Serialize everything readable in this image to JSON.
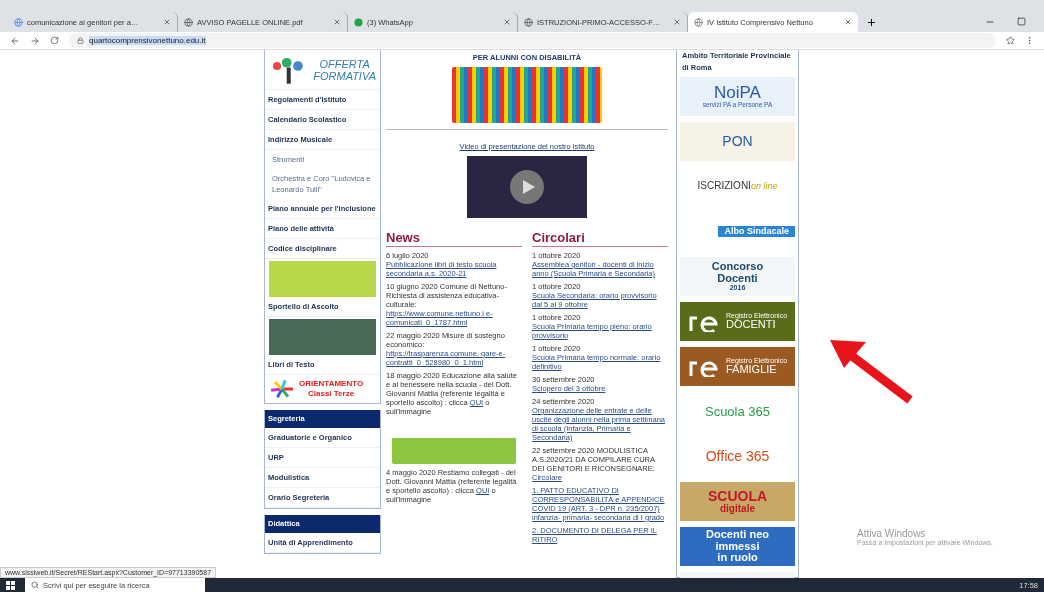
{
  "browser": {
    "tabs": [
      {
        "title": "comunicazione ai genitori per a…",
        "selected": false
      },
      {
        "title": "AVVISO PAGELLE ONLINE.pdf",
        "selected": false
      },
      {
        "title": "(3) WhatsApp",
        "selected": false
      },
      {
        "title": "ISTRUZIONI-PRIMO-ACCESSO-F…",
        "selected": false
      },
      {
        "title": "IV Istituto Comprensivo Nettuno",
        "selected": true
      }
    ],
    "url": "quartocomprensivonettuno.edu.it"
  },
  "left_menu": [
    {
      "kind": "logo",
      "lines": [
        "OFFERTA",
        "FORMATIVA"
      ]
    },
    {
      "kind": "link",
      "label": "Regolamenti d'Istituto"
    },
    {
      "kind": "link",
      "label": "Calendario Scolastico"
    },
    {
      "kind": "link",
      "label": "Indirizzo Musicale"
    },
    {
      "kind": "sublink",
      "label": "Strumenti"
    },
    {
      "kind": "sublink",
      "label": "Orchestra e Coro \"Ludovica e Leonardo Tulli\""
    },
    {
      "kind": "link",
      "label": "Piano annuale per l'inclusione"
    },
    {
      "kind": "link",
      "label": "Piano delle attività"
    },
    {
      "kind": "link",
      "label": "Codice disciplinare"
    },
    {
      "kind": "image_link",
      "label": "Sportello di Ascolto"
    },
    {
      "kind": "image_link",
      "label": "Libri di Testo"
    },
    {
      "kind": "orient",
      "lines": [
        "ORIENTAMENTO",
        "Classi Terze"
      ]
    },
    {
      "kind": "header",
      "label": "Segreteria"
    },
    {
      "kind": "link",
      "label": "Graduatorie e Organico"
    },
    {
      "kind": "link",
      "label": "URP"
    },
    {
      "kind": "link",
      "label": "Modulistica"
    },
    {
      "kind": "link",
      "label": "Orario Segreteria"
    },
    {
      "kind": "header",
      "label": "Didattica"
    },
    {
      "kind": "link",
      "label": "Unità di Apprendimento"
    }
  ],
  "banner": {
    "title": "PER ALUNNI CON DISABILITÀ"
  },
  "video_link": "Video di presentazione del nostro istituto",
  "news": {
    "heading": "News",
    "items": [
      {
        "text": "6 luglio 2020 ",
        "link": "Pubblicazione libri di testo scuola secondaria a.s. 2020-21"
      },
      {
        "text": "10 giugno 2020 Comune di Nettuno- Richiesta di assistenza educativa- culturale:",
        "link": "https://www.comune.nettuno.i e-comunicati_0_1787.html"
      },
      {
        "text": "22 maggio 2020 Misure di sostegno economico: ",
        "link": "https://trasparenza.comune. gare-e-contratti_0_528980_0_1.html"
      },
      {
        "text": "18 maggio 2020 Educazione alla salute e al benessere nella scuola - del Dott. Giovanni Mattia (referente legalità e sportello ascolto) : clicca ",
        "link": "QUI",
        "after": " o sull'immagine"
      },
      {
        "text": "4 maggio 2020 Restiamo collegati - del Dott. Giovanni Mattia (referente legalità e sportello ascolto) : clicca ",
        "link": "QUI",
        "after": " o sull'immagine"
      }
    ]
  },
  "circolari": {
    "heading": "Circolari",
    "items": [
      {
        "text": "1 ottobre 2020 ",
        "link": "Assemblea genitori - docenti di inizio anno (Scuola Primaria e Secondaria)"
      },
      {
        "text": "1 ottobre 2020 ",
        "link": "Scuola Secondaria: orario provvisorio dal 5 al 9 ottobre"
      },
      {
        "text": "1 ottobre 2020 ",
        "link": "Scuola Primaria tempo pieno: orario provvisorio"
      },
      {
        "text": "1 ottobre 2020 ",
        "link": "Scuola Primaria tempo normale: orario definitivo"
      },
      {
        "text": "30 settembre 2020 ",
        "link": "Sciopero del 3 ottobre"
      },
      {
        "text": "24 settembre 2020 ",
        "link": "Organizzazione delle entrate e delle uscite degli alunni nella prima settimana di scuola (Infanzia, Primaria e Secondaria)"
      },
      {
        "text": "22 settembre 2020 MODULISTICA A.S.2020/21 DA COMPILARE CURA DEI GENITORI E RICONSEGNARE: ",
        "link": "Circolare"
      },
      {
        "link": "1. PATTO EDUCATIVO DI CORRESPONSABILITÀ e APPENDICE COVID 19 (ART. 3 - DPR n. 235/2007) infanzia- primaria- secondaria di I grado"
      },
      {
        "link": "2. DOCUMENTO DI DELEGA PER IL RITIRO"
      }
    ]
  },
  "right_panel": {
    "heading_lines": [
      "Ambito Territoriale Provinciale",
      "di Roma"
    ],
    "banners": [
      {
        "kind": "noipa",
        "lines": [
          "NoiPA",
          "servizi PA a Persone PA"
        ]
      },
      {
        "kind": "pon",
        "lines": [
          "PON"
        ]
      },
      {
        "kind": "iscrizioni",
        "lines": [
          "ISCRIZIONI",
          "on line"
        ]
      },
      {
        "kind": "albo",
        "lines": [
          "Albo Sindacale"
        ]
      },
      {
        "kind": "concorso",
        "lines": [
          "Concorso",
          "Docenti",
          "2016"
        ]
      },
      {
        "kind": "re",
        "color": "#5a6b1a",
        "lines": [
          "Registro Elettronico",
          "DOCENTI"
        ]
      },
      {
        "kind": "re",
        "color": "#9a5a22",
        "lines": [
          "Registro Elettronico",
          "FAMIGLIE"
        ]
      },
      {
        "kind": "scuola365",
        "lines": [
          "Scuola 365"
        ]
      },
      {
        "kind": "office365",
        "lines": [
          "Office 365"
        ]
      },
      {
        "kind": "digitale",
        "lines": [
          "SCUOLA",
          "digitale"
        ]
      },
      {
        "kind": "neo",
        "lines": [
          "Docenti neo",
          "immessi",
          "in ruolo"
        ]
      },
      {
        "kind": "sketch"
      }
    ]
  },
  "status_url": "www.sissiweb.it/Secret/REStart.aspx?Customer_ID=97713390587",
  "activation": {
    "title": "Attiva Windows",
    "text": "Passa a Impostazioni per attivare Windows."
  },
  "taskbar": {
    "search_placeholder": "Scrivi qui per eseguire la ricerca",
    "time": "17:58"
  }
}
